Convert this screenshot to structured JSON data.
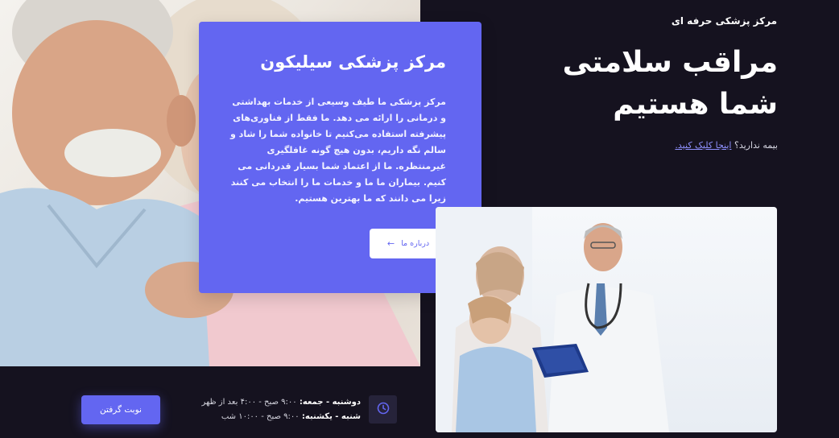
{
  "hero": {
    "eyebrow": "مرکز پزشکی حرفه ای",
    "headline_line1": "مراقب سلامتی",
    "headline_line2": "شما هستیم",
    "insurance_question": "بیمه ندارید؟",
    "insurance_link": "اینجا کلیک کنید."
  },
  "about": {
    "title": "مرکز پزشکی سیلیکون",
    "text": "مرکز پزشکی ما طیف وسیعی از خدمات بهداشتی و درمانی را ارائه می دهد. ما فقط از فناوری‌های پیشرفته استفاده می‌کنیم تا خانواده شما را شاد و سالم نگه داریم، بدون هیچ گونه غافلگیری غیرمنتظره. ما از اعتماد شما بسیار قدردانی می کنیم. بیماران ما ما و خدمات ما را انتخاب می کنند زیرا می دانند که ما بهترین هستیم.",
    "button_label": "درباره ما"
  },
  "hours": {
    "line1_days": "دوشنبه - جمعه:",
    "line1_time": "۹:۰۰ صبح - ۴:۰۰ بعد از ظهر",
    "line2_days": "شنبه - یکشنبه:",
    "line2_time": "۹:۰۰ صبح - ۱۰:۰۰ شب",
    "icon": "clock-icon"
  },
  "appointment": {
    "button_label": "نوبت گرفتن"
  },
  "colors": {
    "background": "#15121f",
    "accent": "#6366f1",
    "link": "#8f91ff"
  }
}
